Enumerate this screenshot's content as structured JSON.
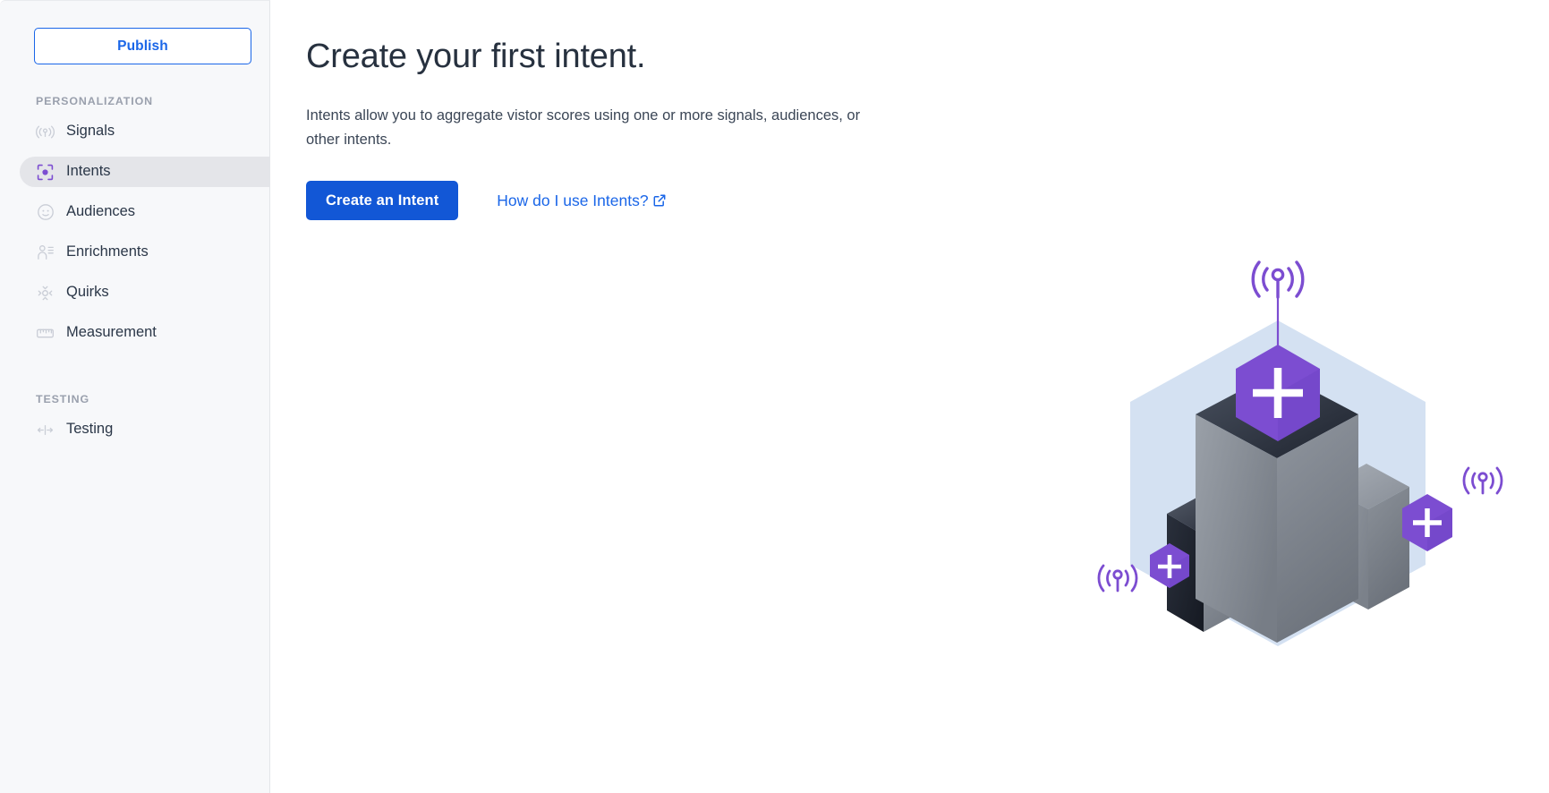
{
  "sidebar": {
    "publish_label": "Publish",
    "sections": [
      {
        "label": "PERSONALIZATION",
        "items": [
          {
            "label": "Signals",
            "icon": "signal-tower-icon",
            "active": false
          },
          {
            "label": "Intents",
            "icon": "focus-target-icon",
            "active": true
          },
          {
            "label": "Audiences",
            "icon": "face-circle-icon",
            "active": false
          },
          {
            "label": "Enrichments",
            "icon": "person-list-icon",
            "active": false
          },
          {
            "label": "Quirks",
            "icon": "move-diamond-icon",
            "active": false
          },
          {
            "label": "Measurement",
            "icon": "ruler-icon",
            "active": false
          }
        ]
      },
      {
        "label": "TESTING",
        "items": [
          {
            "label": "Testing",
            "icon": "ab-split-arrows-icon",
            "active": false
          }
        ]
      }
    ]
  },
  "main": {
    "title": "Create your first intent.",
    "description": "Intents allow you to aggregate vistor scores using one or more signals, audiences, or other intents.",
    "primary_button_label": "Create an Intent",
    "help_link_label": "How do I use Intents?",
    "help_link_icon": "external-link-icon"
  },
  "illustration": {
    "name": "isometric-intent-blocks-illustration",
    "hex_backdrop_color": "#cddcf0",
    "accent_purple": "#7c4dd1",
    "accent_purple_dark": "#6b3fc0",
    "block_light": "#9ba0a8",
    "block_dark": "#2b3240",
    "badge_icon": "plus-hexagon-badge",
    "signal_icon": "signal-tower-icon",
    "badge_count": 3,
    "signal_count": 3
  },
  "colors": {
    "brand_blue": "#1257d6",
    "link_blue": "#1a66e8",
    "sidebar_bg": "#f7f8fa",
    "active_item_bg": "#e4e5e9",
    "text_dark": "#27313f",
    "muted_label": "#9aa0ad",
    "accent_purple": "#7c4dd1"
  }
}
